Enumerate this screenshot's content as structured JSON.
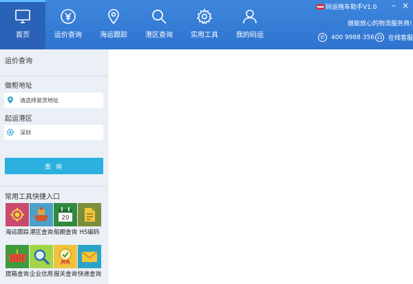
{
  "app": {
    "title": "码运拖车助手V1.0",
    "slogan": "做能放心的物流服务商!",
    "phone": "400 9988 356",
    "online_service": "在线客服",
    "minimize": "–",
    "close": "×"
  },
  "nav": {
    "tabs": [
      {
        "label": "首页",
        "icon": "monitor-icon",
        "active": true
      },
      {
        "label": "运价查询",
        "icon": "price-coin-icon"
      },
      {
        "label": "海运跟踪",
        "icon": "location-pin-icon"
      },
      {
        "label": "港区查询",
        "icon": "search-icon"
      },
      {
        "label": "实用工具",
        "icon": "gear-icon"
      },
      {
        "label": "我的码运",
        "icon": "user-icon"
      }
    ]
  },
  "sidebar": {
    "section_title": "运价查询",
    "pickup_label": "做柜地址",
    "pickup_placeholder": "请选择装货地址",
    "origin_label": "起运港区",
    "origin_value": "深圳",
    "query_button": "查 询",
    "tools_title": "常用工具快捷入口",
    "tools": [
      {
        "label": "海运跟踪",
        "color": "#c94a6e",
        "icon": "crosshair-target-icon"
      },
      {
        "label": "港区查询",
        "color": "#4aa0c8",
        "icon": "ship-icon"
      },
      {
        "label": "船期查询",
        "color": "#2f8a3e",
        "icon": "calendar-icon",
        "calendar_day": "20"
      },
      {
        "label": "HS编码",
        "color": "#7a8f3a",
        "icon": "document-icon"
      },
      {
        "label": "提箱查询",
        "color": "#3d9a3d",
        "icon": "container-icon"
      },
      {
        "label": "企业信用",
        "color": "#a2d548",
        "icon": "magnifier-icon"
      },
      {
        "label": "报关查询",
        "color": "#f1c23c",
        "icon": "badge-icon"
      },
      {
        "label": "快递查询",
        "color": "#2aa3c8",
        "icon": "envelope-icon"
      }
    ]
  },
  "colors": {
    "header": "#3479d4",
    "active_tab": "#2a62b8",
    "sidebar": "#ebeff6",
    "query_button": "#2ab1df"
  }
}
